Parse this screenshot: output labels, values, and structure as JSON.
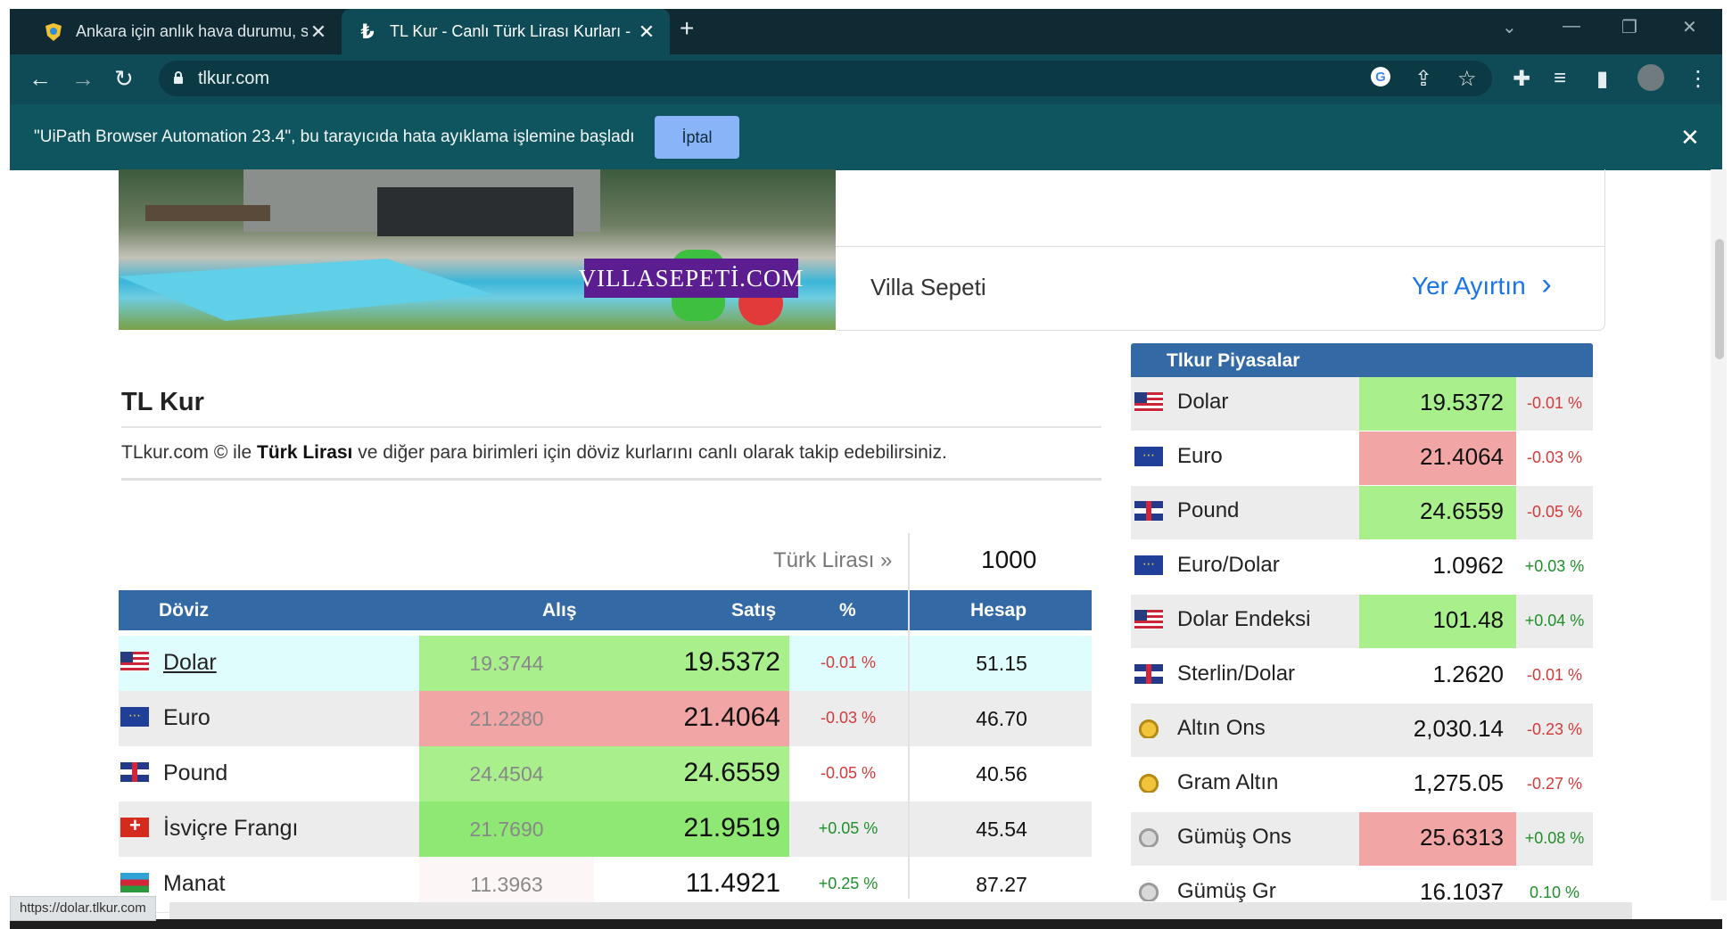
{
  "browser": {
    "tabs": [
      {
        "title": "Ankara için anlık hava durumu, s",
        "active": false,
        "favicon": "weather-shield-icon"
      },
      {
        "title": "TL Kur - Canlı Türk Lirası Kurları -",
        "active": true,
        "favicon": "lira-icon"
      }
    ],
    "url": "tlkur.com",
    "infobar_text": "\"UiPath Browser Automation 23.4\", bu tarayıcıda hata ayıklama işlemine başladı",
    "infobar_button": "İptal",
    "status_url": "https://dolar.tlkur.com"
  },
  "ad": {
    "brand": "VILLASEPETİ.COM",
    "name": "Villa Sepeti",
    "cta": "Yer Ayırtın",
    "cta_arrow": "›"
  },
  "main": {
    "title": "TL Kur",
    "desc_prefix": "TLkur.com © ile ",
    "desc_bold": "Türk Lirası",
    "desc_suffix": " ve diğer para birimleri için döviz kurlarını canlı olarak takip edebilirsiniz.",
    "try_label": "Türk Lirası »",
    "try_amount": "1000",
    "headers": {
      "doviz": "Döviz",
      "alis": "Alış",
      "satis": "Satış",
      "pct": "%",
      "hesap": "Hesap"
    },
    "rows": [
      {
        "flag": "us",
        "name": "Dolar",
        "buy": "19.3744",
        "sell": "19.5372",
        "pct": "-0.01 %",
        "dir": "down",
        "calc": "51.15",
        "buy_bg": "#a9f08d",
        "sell_bg": "#a9f08d",
        "pct_bg": "#e0fdfd",
        "name_bg": "#e0fdfd",
        "underline": true
      },
      {
        "flag": "eu",
        "name": "Euro",
        "buy": "21.2280",
        "sell": "21.4064",
        "pct": "-0.03 %",
        "dir": "down",
        "calc": "46.70",
        "buy_bg": "#f2a5a5",
        "sell_bg": "#f2a5a5",
        "pct_bg": "#ececec",
        "name_bg": "#ececec",
        "underline": false
      },
      {
        "flag": "uk",
        "name": "Pound",
        "buy": "24.4504",
        "sell": "24.6559",
        "pct": "-0.05 %",
        "dir": "down",
        "calc": "40.56",
        "buy_bg": "#a9f08d",
        "sell_bg": "#a9f08d",
        "pct_bg": "#ffffff",
        "name_bg": "#ffffff",
        "underline": false
      },
      {
        "flag": "ch",
        "name": "İsviçre Frangı",
        "buy": "21.7690",
        "sell": "21.9519",
        "pct": "+0.05 %",
        "dir": "up",
        "calc": "45.54",
        "buy_bg": "#8fe873",
        "sell_bg": "#8fe873",
        "pct_bg": "#ececec",
        "name_bg": "#ececec",
        "underline": false
      },
      {
        "flag": "az",
        "name": "Manat",
        "buy": "11.3963",
        "sell": "11.4921",
        "pct": "+0.25 %",
        "dir": "up",
        "calc": "87.27",
        "buy_bg": "#fdf6f6",
        "sell_bg": "#ffffff",
        "pct_bg": "#ffffff",
        "name_bg": "#ffffff",
        "underline": false
      }
    ]
  },
  "side": {
    "title": "Tlkur Piyasalar",
    "rows": [
      {
        "flag": "us",
        "name": "Dolar",
        "value": "19.5372",
        "pct": "-0.01 %",
        "dir": "down",
        "bg": "#a9f08d",
        "row_bg": "#ececec"
      },
      {
        "flag": "eu",
        "name": "Euro",
        "value": "21.4064",
        "pct": "-0.03 %",
        "dir": "down",
        "bg": "#f2a5a5",
        "row_bg": "#ffffff"
      },
      {
        "flag": "uk",
        "name": "Pound",
        "value": "24.6559",
        "pct": "-0.05 %",
        "dir": "down",
        "bg": "#a9f08d",
        "row_bg": "#ececec"
      },
      {
        "flag": "eu",
        "name": "Euro/Dolar",
        "value": "1.0962",
        "pct": "+0.03 %",
        "dir": "up",
        "bg": "transparent",
        "row_bg": "#ffffff"
      },
      {
        "flag": "us",
        "name": "Dolar Endeksi",
        "value": "101.48",
        "pct": "+0.04 %",
        "dir": "up",
        "bg": "#a9f08d",
        "row_bg": "#ececec"
      },
      {
        "flag": "uk",
        "name": "Sterlin/Dolar",
        "value": "1.2620",
        "pct": "-0.01 %",
        "dir": "down",
        "bg": "transparent",
        "row_bg": "#ffffff"
      },
      {
        "flag": "gold",
        "name": "Altın Ons",
        "value": "2,030.14",
        "pct": "-0.23 %",
        "dir": "down",
        "bg": "transparent",
        "row_bg": "#ececec"
      },
      {
        "flag": "gold",
        "name": "Gram Altın",
        "value": "1,275.05",
        "pct": "-0.27 %",
        "dir": "down",
        "bg": "transparent",
        "row_bg": "#ffffff"
      },
      {
        "flag": "silver",
        "name": "Gümüş Ons",
        "value": "25.6313",
        "pct": "+0.08 %",
        "dir": "up",
        "bg": "#f2a5a5",
        "row_bg": "#ececec"
      },
      {
        "flag": "silver",
        "name": "Gümüş Gr",
        "value": "16.1037",
        "pct": "0.10 %",
        "dir": "up",
        "bg": "transparent",
        "row_bg": "#ffffff"
      }
    ]
  }
}
